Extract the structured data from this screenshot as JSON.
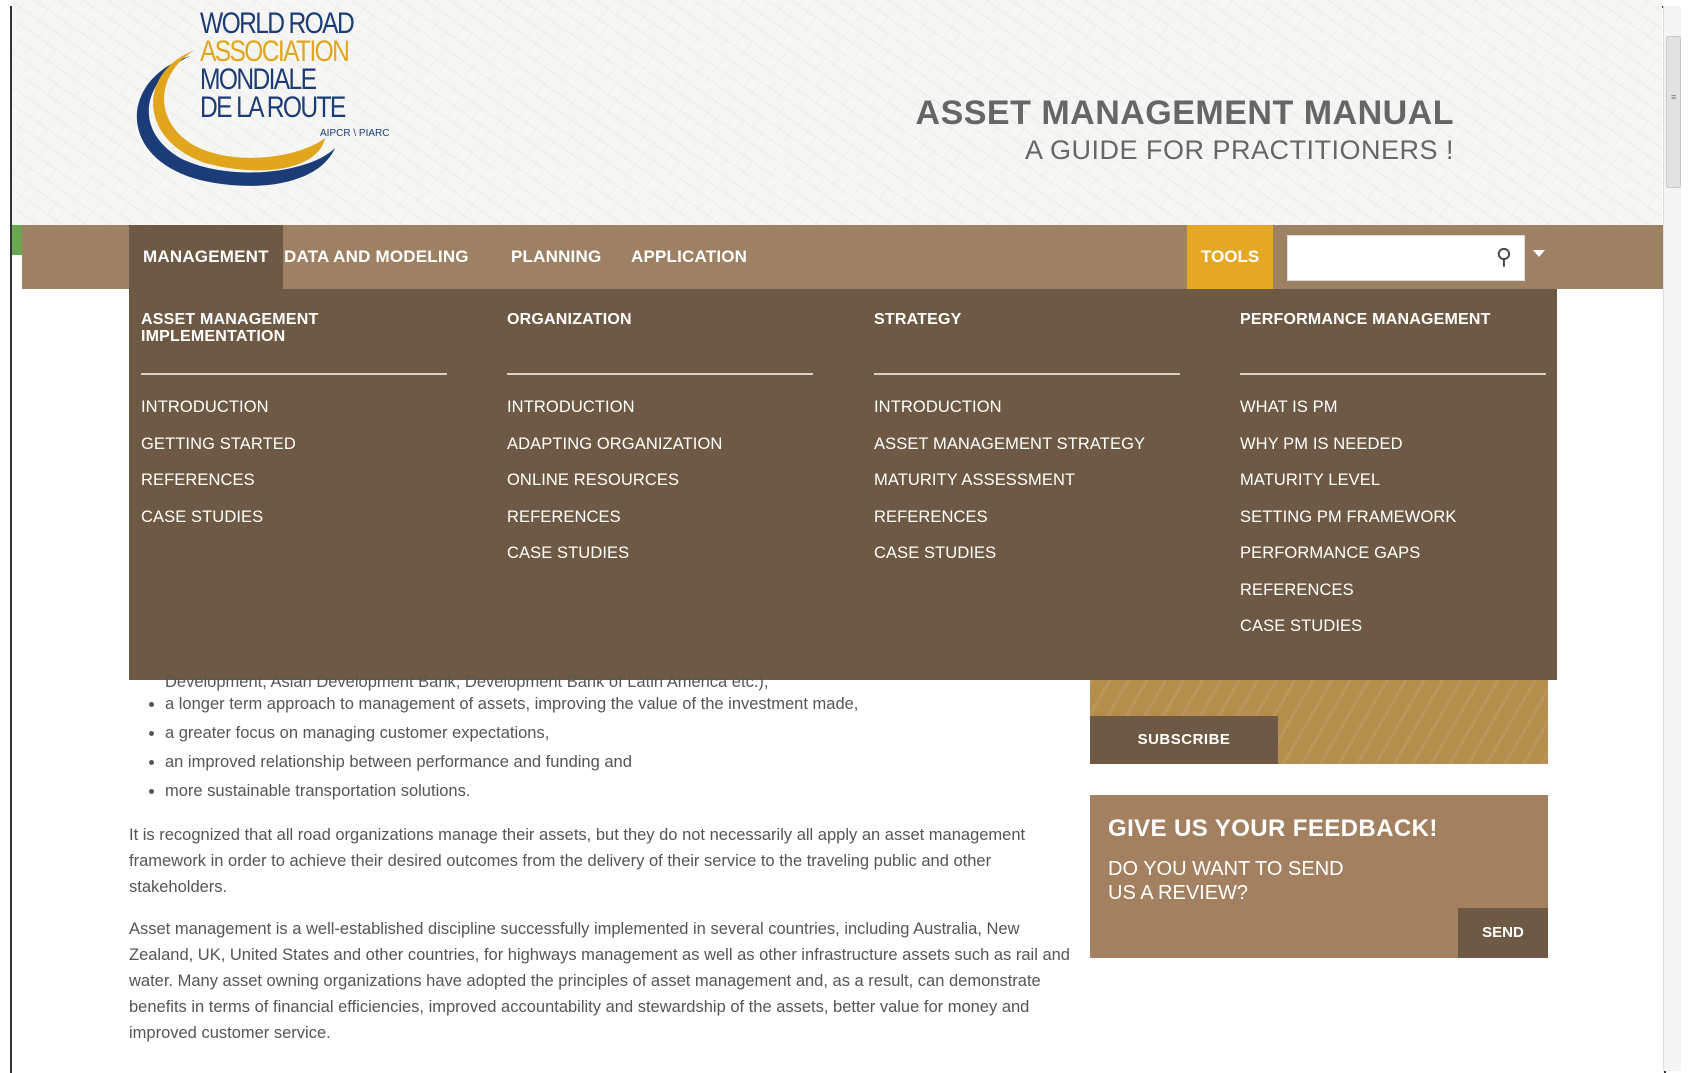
{
  "logo": {
    "line1": "WORLD ROAD",
    "line2": "ASSOCIATION",
    "line3": "MONDIALE",
    "line4": "DE LA ROUTE",
    "sub": "AIPCR \\ PIARC"
  },
  "site": {
    "title": "ASSET MANAGEMENT MANUAL",
    "subtitle": "A GUIDE FOR PRACTITIONERS !"
  },
  "nav": {
    "items": [
      {
        "label": "MANAGEMENT"
      },
      {
        "label": "DATA AND MODELING"
      },
      {
        "label": "PLANNING"
      },
      {
        "label": "APPLICATION"
      }
    ],
    "tools": "TOOLS",
    "search_placeholder": "",
    "search_icon": "search-icon",
    "dropdown_icon": "caret-down-icon"
  },
  "mega_menu": {
    "columns": [
      {
        "heading": "ASSET MANAGEMENT IMPLEMENTATION",
        "items": [
          "INTRODUCTION",
          "GETTING STARTED",
          "REFERENCES",
          "CASE STUDIES"
        ]
      },
      {
        "heading": "ORGANIZATION",
        "items": [
          "INTRODUCTION",
          "ADAPTING ORGANIZATION",
          "ONLINE RESOURCES",
          "REFERENCES",
          "CASE STUDIES"
        ]
      },
      {
        "heading": "STRATEGY",
        "items": [
          "INTRODUCTION",
          "ASSET MANAGEMENT STRATEGY",
          "MATURITY ASSESSMENT",
          "REFERENCES",
          "CASE STUDIES"
        ]
      },
      {
        "heading": "PERFORMANCE MANAGEMENT",
        "items": [
          "WHAT IS PM",
          "WHY PM IS NEEDED",
          "MATURITY LEVEL",
          "SETTING PM FRAMEWORK",
          "PERFORMANCE GAPS",
          "REFERENCES",
          "CASE STUDIES"
        ]
      }
    ]
  },
  "content": {
    "partial_line": "Development, Asian Development Bank, Development Bank of Latin America etc.),",
    "bullets": [
      "a longer term approach to management of assets, improving the value of the investment made,",
      "a greater focus on managing customer expectations,",
      "an improved relationship between performance and funding and",
      "more sustainable transportation solutions."
    ],
    "para1": "It is recognized that all road organizations manage their assets, but they do not necessarily all apply an asset management framework in order to achieve their desired outcomes from the delivery of their service to the traveling public and other stakeholders.",
    "para2": "Asset management is a well-established discipline successfully implemented in several countries, including Australia, New Zealand, UK, United States and other countries, for highways management as well as other infrastructure assets such as rail and water. Many asset owning organizations have adopted the principles of asset management and, as a result, can demonstrate benefits in terms of financial efficiencies, improved accountability and stewardship of the assets, better value for money and improved customer service."
  },
  "sidebar": {
    "subscribe_label": "SUBSCRIBE",
    "feedback_title": "GIVE US YOUR FEEDBACK!",
    "feedback_text": "DO YOU WANT TO SEND US A REVIEW?",
    "send_label": "SEND"
  },
  "colors": {
    "nav_bg": "#9e8163",
    "mega_bg": "#6e5a44",
    "tools_bg": "#e5a824",
    "logo_blue": "#1b3c77",
    "logo_gold": "#e1a61d"
  }
}
